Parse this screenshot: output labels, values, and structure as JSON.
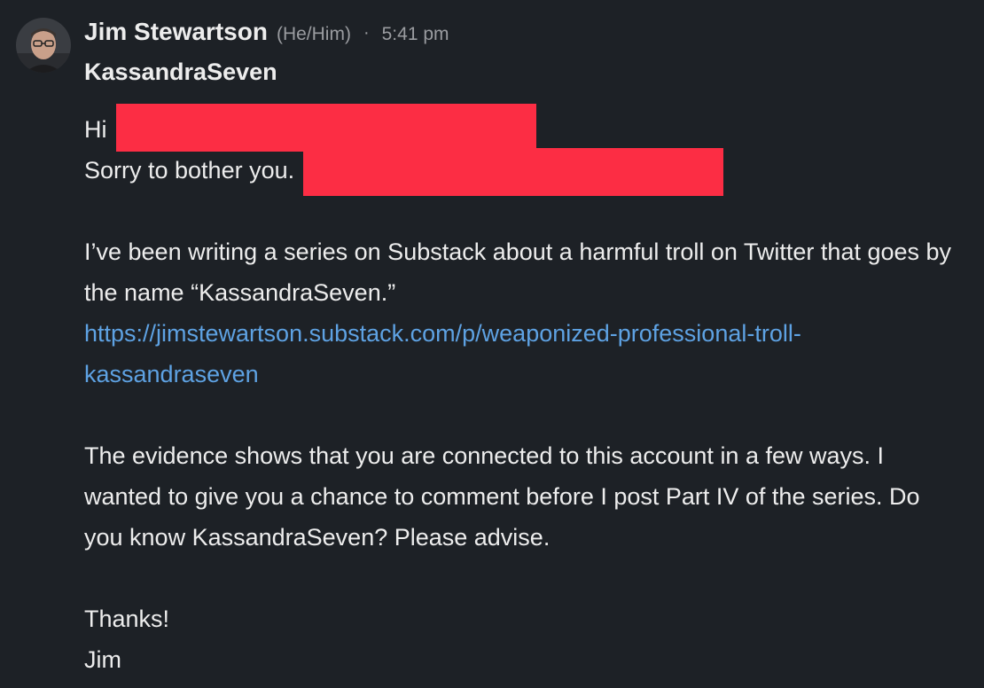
{
  "sender": {
    "name": "Jim Stewartson",
    "pronouns": "(He/Him)",
    "separator": "·",
    "time": "5:41 pm"
  },
  "subject": "KassandraSeven",
  "message": {
    "greeting": "Hi",
    "apology": "Sorry to bother you.",
    "paragraph1": "I’ve been writing a series on Substack about a harmful troll on Twitter that goes by the name “KassandraSeven.”",
    "link_line1": "https://jimstewartson.substack.com/p/weaponized-professional-troll-",
    "link_line2": "kassandraseven",
    "paragraph2": "The evidence shows that you are connected to this account in a few ways. I wanted to give you a chance to comment before I post Part IV of the series. Do you know KassandraSeven? Please advise.",
    "closing": "Thanks!",
    "signature": "Jim"
  },
  "colors": {
    "background": "#1d2126",
    "text": "#ededed",
    "muted": "#9a9ca0",
    "link": "#5ea2e3",
    "redaction": "#fc2d44"
  },
  "icons": {
    "avatar": "profile-photo"
  }
}
